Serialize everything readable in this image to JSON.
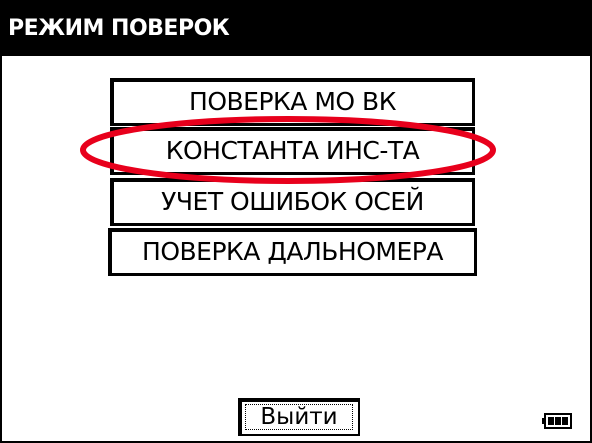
{
  "window": {
    "title": "РЕЖИМ ПОВЕРОК"
  },
  "menu": {
    "items": [
      {
        "label": "ПОВЕРКА МО ВК"
      },
      {
        "label": "КОНСТАНТА ИНС-ТА"
      },
      {
        "label": "УЧЕТ ОШИБОК ОСЕЙ"
      },
      {
        "label": "ПОВЕРКА ДАЛЬНОМЕРА"
      }
    ],
    "highlighted_index": 1,
    "highlight_color": "#e8001c"
  },
  "footer": {
    "exit_label": "Выйти",
    "battery_icon": "battery-icon"
  }
}
